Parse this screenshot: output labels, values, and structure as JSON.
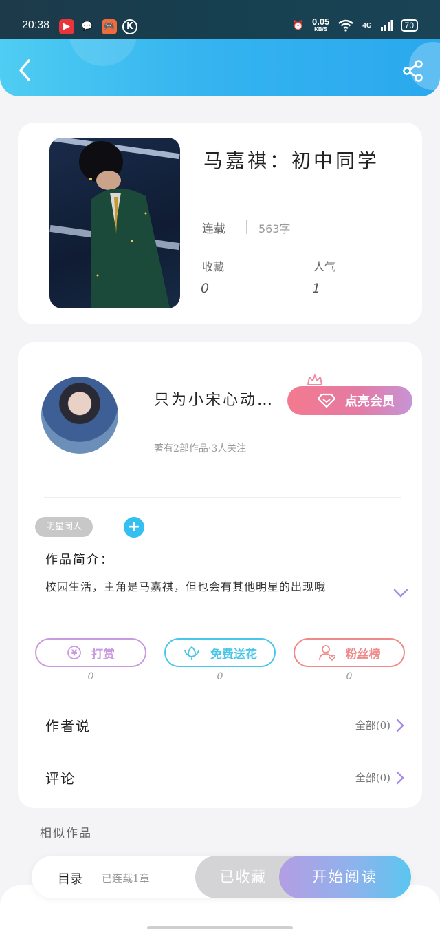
{
  "status_bar": {
    "time": "20:38",
    "net_speed": "0.05",
    "net_unit": "KB/S",
    "signal": "4G",
    "battery": "70"
  },
  "header": {
    "back_icon": "chevron-left-icon",
    "share_icon": "share-icon"
  },
  "book": {
    "title": "马嘉祺：初中同学",
    "status": "连载",
    "words": "563字",
    "stats": [
      {
        "label": "收藏",
        "value": "0"
      },
      {
        "label": "人气",
        "value": "1"
      }
    ]
  },
  "author": {
    "name": "只为小宋心动…",
    "vip_label": "点亮会员",
    "meta": "著有2部作品·3人关注"
  },
  "tags": [
    "明星同人"
  ],
  "intro": {
    "label": "作品简介：",
    "text": "校园生活，主角是马嘉祺，但也会有其他明星的出现哦"
  },
  "actions": [
    {
      "label": "打赏",
      "count": "0",
      "color": "#c89be0"
    },
    {
      "label": "免费送花",
      "count": "0",
      "color": "#49c7e8"
    },
    {
      "label": "粉丝榜",
      "count": "0",
      "color": "#ef8a8a"
    }
  ],
  "rows": [
    {
      "label": "作者说",
      "right": "全部(0)"
    },
    {
      "label": "评论",
      "right": "全部(0)"
    }
  ],
  "similar_title": "相似作品",
  "bottom": {
    "toc": "目录",
    "toc_sub": "已连载1章",
    "collected": "已收藏",
    "read": "开始阅读"
  },
  "colors": {
    "accent_blue": "#35b4f0",
    "accent_purple": "#a98ee0"
  }
}
